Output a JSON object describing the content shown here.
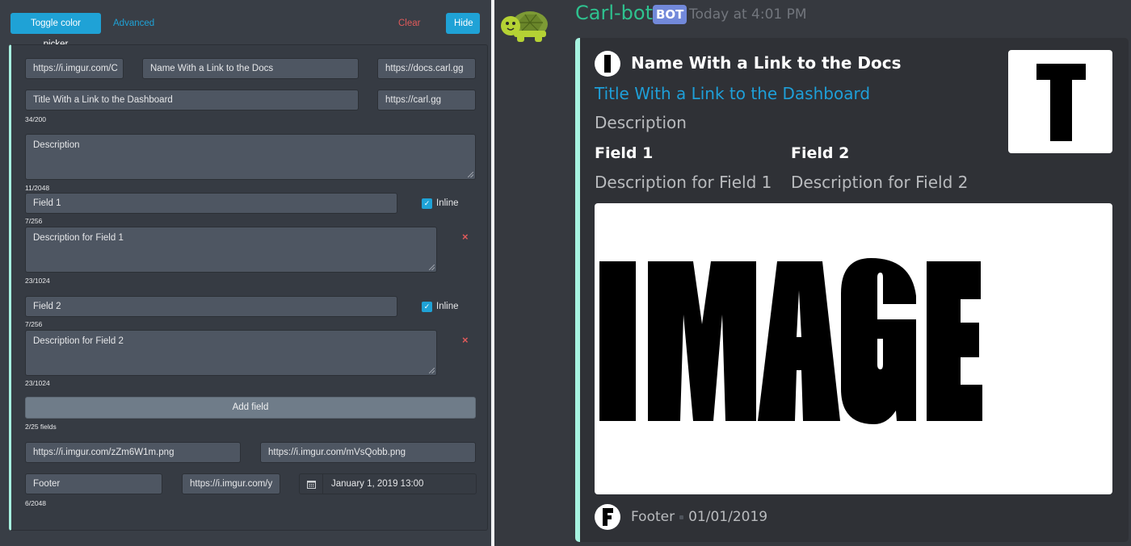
{
  "toolbar": {
    "toggle_color_picker": "Toggle color picker",
    "advanced": "Advanced",
    "clear": "Clear",
    "hide": "Hide"
  },
  "builder": {
    "author_icon_url": "https://i.imgur.com/C",
    "author_name": "Name With a Link to the Docs",
    "author_url": "https://docs.carl.gg",
    "title": "Title With a Link to the Dashboard",
    "title_url": "https://carl.gg",
    "title_count": "34/200",
    "description": "Description",
    "description_count": "11/2048",
    "fields": [
      {
        "name": "Field 1",
        "name_count": "7/256",
        "inline_label": "Inline",
        "inline": true,
        "value": "Description for Field 1",
        "value_count": "23/1024",
        "delete_icon": "×"
      },
      {
        "name": "Field 2",
        "name_count": "7/256",
        "inline_label": "Inline",
        "inline": true,
        "value": "Description for Field 2",
        "value_count": "23/1024",
        "delete_icon": "×"
      }
    ],
    "add_field": "Add field",
    "fields_count": "2/25 fields",
    "image_url": "https://i.imgur.com/zZm6W1m.png",
    "thumbnail_url": "https://i.imgur.com/mVsQobb.png",
    "footer_text": "Footer",
    "footer_icon_url": "https://i.imgur.com/y",
    "timestamp": "January 1, 2019 13:00",
    "footer_count": "6/2048"
  },
  "preview": {
    "bot_name": "Carl-bot",
    "bot_badge": "BOT",
    "message_time": "Today at 4:01 PM",
    "embed": {
      "author": "Name With a Link to the Docs",
      "title": "Title With a Link to the Dashboard",
      "description": "Description",
      "fields": [
        {
          "name": "Field 1",
          "value": "Description for Field 1"
        },
        {
          "name": "Field 2",
          "value": "Description for Field 2"
        }
      ],
      "thumbnail_text": "T",
      "image_text": "IMAGE",
      "footer_text": "Footer",
      "footer_date": "01/01/2019",
      "accent_color": "#a7f3e0"
    }
  },
  "colors": {
    "accent_blue": "#1fa2d6",
    "danger_red": "#e05a5a",
    "bot_green": "#2ec28f",
    "badge_blurple": "#7289da",
    "link_blue": "#1e9fd8"
  }
}
